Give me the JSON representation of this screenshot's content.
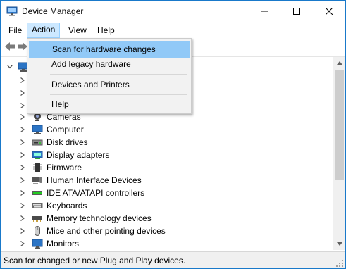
{
  "window": {
    "title": "Device Manager"
  },
  "menubar": {
    "file": "File",
    "action": "Action",
    "view": "View",
    "help": "Help"
  },
  "action_menu": {
    "items": [
      {
        "label": "Scan for hardware changes",
        "highlighted": true
      },
      {
        "label": "Add legacy hardware"
      },
      {
        "label": "Devices and Printers"
      },
      {
        "label": "Help"
      }
    ]
  },
  "tree": {
    "items": [
      {
        "label": "Cameras",
        "icon": "camera-icon"
      },
      {
        "label": "Computer",
        "icon": "computer-icon"
      },
      {
        "label": "Disk drives",
        "icon": "disk-drive-icon"
      },
      {
        "label": "Display adapters",
        "icon": "display-adapter-icon"
      },
      {
        "label": "Firmware",
        "icon": "firmware-chip-icon"
      },
      {
        "label": "Human Interface Devices",
        "icon": "hid-icon"
      },
      {
        "label": "IDE ATA/ATAPI controllers",
        "icon": "ide-controller-icon"
      },
      {
        "label": "Keyboards",
        "icon": "keyboard-icon"
      },
      {
        "label": "Memory technology devices",
        "icon": "memory-icon"
      },
      {
        "label": "Mice and other pointing devices",
        "icon": "mouse-icon"
      },
      {
        "label": "Monitors",
        "icon": "monitor-icon"
      }
    ]
  },
  "statusbar": {
    "text": "Scan for changed or new Plug and Play devices."
  },
  "colors": {
    "accent": "#1979ca",
    "menu_highlight": "#91c9f7",
    "menu_bg": "#f2f2f2",
    "status_bg": "#f0f0f0"
  }
}
